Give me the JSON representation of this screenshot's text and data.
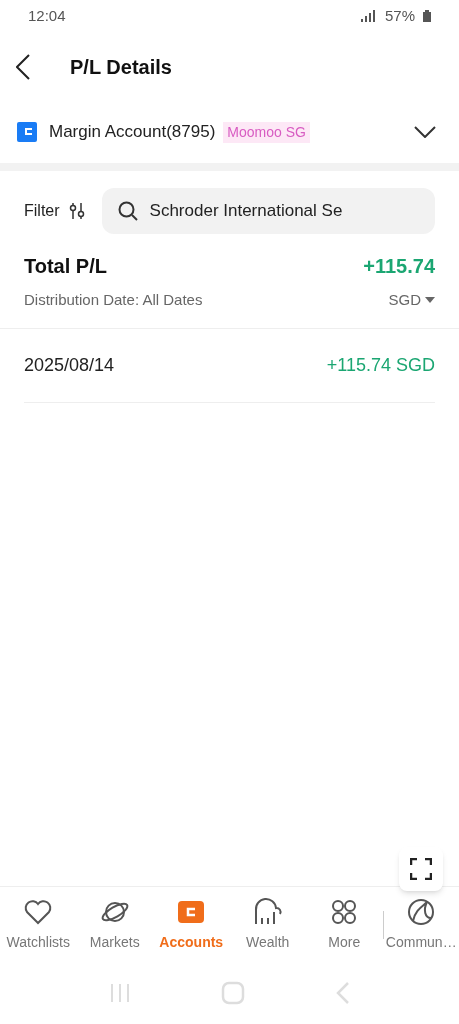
{
  "status_bar": {
    "time": "12:04",
    "battery": "57%"
  },
  "header": {
    "title": "P/L Details"
  },
  "account": {
    "name": "Margin Account(8795)",
    "badge": "Moomoo SG"
  },
  "filter": {
    "label": "Filter"
  },
  "search": {
    "value": "Schroder International Se"
  },
  "summary": {
    "title": "Total P/L",
    "value": "+115.74",
    "subtitle": "Distribution Date: All Dates",
    "currency": "SGD"
  },
  "rows": [
    {
      "date": "2025/08/14",
      "amount": "+115.74 SGD"
    }
  ],
  "tabs": [
    {
      "kind": "heart",
      "label": "Watchlists",
      "selected": false
    },
    {
      "kind": "planet",
      "label": "Markets",
      "selected": false
    },
    {
      "kind": "wallet",
      "label": "Accounts",
      "selected": true
    },
    {
      "kind": "elephant",
      "label": "Wealth",
      "selected": false
    },
    {
      "kind": "grid",
      "label": "More",
      "selected": false
    },
    {
      "kind": "circle",
      "label": "Commun…",
      "selected": false
    }
  ]
}
